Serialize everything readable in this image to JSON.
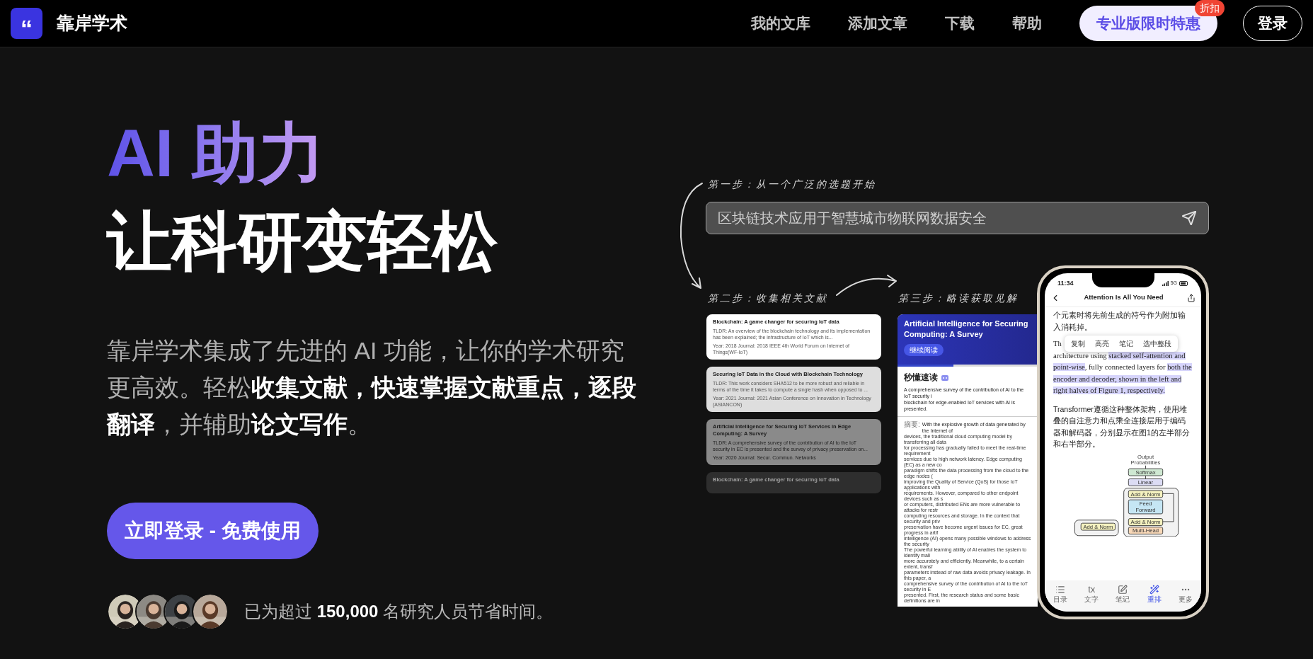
{
  "header": {
    "logo_glyph": "“",
    "brand": "靠岸学术",
    "nav": [
      {
        "label": "我的文库"
      },
      {
        "label": "添加文章"
      },
      {
        "label": "下载"
      },
      {
        "label": "帮助"
      }
    ],
    "promo_button": {
      "label": "专业版限时特惠",
      "badge": "折扣"
    },
    "login_button": "登录"
  },
  "hero": {
    "title_accent": "AI 助力",
    "title": "让科研变轻松",
    "description": "靠岸学术集成了先进的 AI 功能，让你的学术研究更高效。轻松**收集文献，快速掌握文献重点，逐段翻译**，并辅助**论文写作**。",
    "cta": "立即登录 - 免费使用",
    "social_proof": "已为超过 **150,000** 名研究人员节省时间。"
  },
  "demo": {
    "steps": [
      "第一步：从一个广泛的选题开始",
      "第二步：收集相关文献",
      "第三步：略读获取见解"
    ],
    "search": {
      "value": "区块链技术应用于智慧城市物联网数据安全"
    },
    "papers": [
      {
        "title": "Blockchain: A game changer for securing IoT data",
        "tldr": "TLDR: An overview of the blockchain technology and its implementation has been explained; the infrastructure of IoT which is...",
        "meta": "Year: 2018 Journal: 2018 IEEE 4th World Forum on Internet of Things(WF-IoT)"
      },
      {
        "title": "Securing IoT Data in the Cloud with Blockchain Technology",
        "tldr": "TLDR: This work considers SHA512 to be more robust and reliable in terms of the time it takes to compute a single hash when opposed to ...",
        "meta": "Year: 2021 Journal: 2021 Asian Conference on Innovation in Technology (ASIANCON)"
      },
      {
        "title": "Artificial Intelligence for Securing IoT Services in Edge Computing: A Survey",
        "tldr": "TLDR: A comprehensive survey of the contribution of AI to the IoT security in EC is presented and the survey of privacy preservation on...",
        "meta": "Year: 2020 Journal: Secur. Commun. Networks"
      },
      {
        "title": "Blockchain: A game changer for securing IoT data"
      }
    ],
    "reader": {
      "title_lines": [
        "Artificial Intelligence for Securing",
        "Computing: A Survey"
      ],
      "button": "继续阅读",
      "level": 0.4,
      "summary_heading": "秒懂速读",
      "summary_lines": [
        "A comprehensive survey of the contribution of AI to the IoT security i",
        "blockchain for edge-enabled IoT services with AI is presented."
      ],
      "abstract_label": "摘要:",
      "abstract_lines": [
        "With the explosive growth of data generated by the Internet of",
        "devices, the traditional cloud computing model by transferring all data",
        "for processing has gradually failed to meet the real-time requirement",
        "services due to high network latency. Edge computing (EC) as a new co",
        "paradigm shifts the data processing from the cloud to the edge nodes (",
        "improving the Quality of Service (QoS) for those IoT applications with",
        "requirements. However, compared to other endpoint devices such as s",
        "or computers, distributed ENs are more vulnerable to attacks for restr",
        "computing resources and storage. In the context that security and priv",
        "preservation have become urgent issues for EC, great progress in artif",
        "intelligence (AI) opens many possible windows to address the security",
        "The powerful learning ability of AI enables the system to identify mali",
        "more accurately and efficiently. Meanwhile, to a certain extent, transf",
        "parameters instead of raw data avoids privacy leakage. In this paper, a",
        "comprehensive survey of the contribution of AI to the IoT security in E",
        "presented. First, the research status and some basic definitions are in"
      ]
    },
    "phone": {
      "time": "11:34",
      "network": "5G",
      "title": "Attention Is All You Need",
      "para_top": "个元素时将先前生成的符号作为附加输入消耗掉。",
      "menu": [
        "复制",
        "高亮",
        "笔记",
        "选中整段"
      ],
      "en_start": "Th",
      "en_segments": [
        {
          "text": "architecture using ",
          "highlighted": false
        },
        {
          "text": "stacked self-attention and point-wise",
          "highlighted": true
        },
        {
          "text": ", fully connected layers for ",
          "highlighted": false
        },
        {
          "text": "both the encoder and decoder, shown in the left and right halves of Figure 1, respectively.",
          "highlighted": true
        }
      ],
      "zh_para": "Transformer遵循这种整体架构，使用堆叠的自注意力和点乘全连接层用于编码器和解码器，分别显示在图1的左半部分和右半部分。",
      "diagram": {
        "output": [
          "Output",
          "Probabilities"
        ],
        "softmax": "Softmax",
        "linear": "Linear",
        "add_norm": [
          "Add & Norm",
          "Add & Norm",
          "Add & Norm"
        ],
        "feed_forward": [
          "Feed",
          "Forward"
        ],
        "multi_head": "Multi-Head"
      },
      "tabs": [
        {
          "label": "目录",
          "selected": false
        },
        {
          "label": "文字",
          "icon_text": "tx",
          "selected": false
        },
        {
          "label": "笔记",
          "selected": false
        },
        {
          "label": "重排",
          "selected": true
        },
        {
          "label": "更多",
          "selected": false
        }
      ]
    }
  }
}
